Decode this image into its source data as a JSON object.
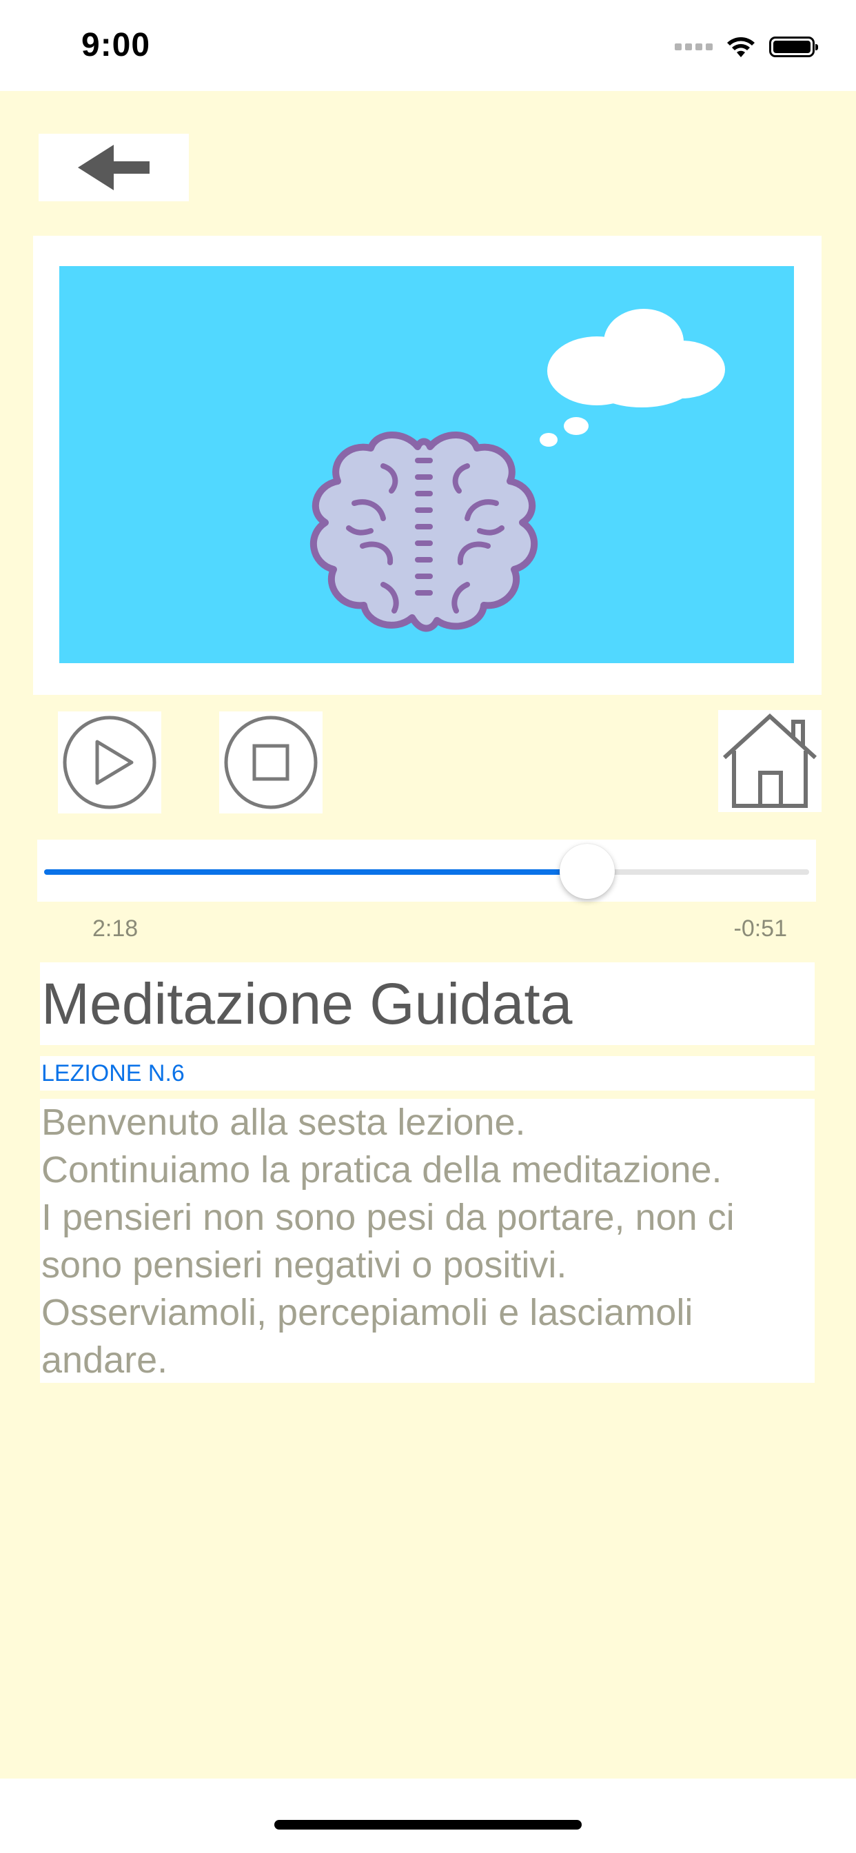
{
  "status_bar": {
    "time": "9:00"
  },
  "icons": {
    "back": "arrow-left-icon",
    "play": "play-circle-icon",
    "stop": "stop-circle-icon",
    "home": "house-icon",
    "illustration": "brain-thinking-illustration"
  },
  "player": {
    "progress": 0.71,
    "elapsed": "2:18",
    "remaining": "-0:51"
  },
  "lesson": {
    "title": "Meditazione Guidata",
    "number": "LEZIONE N.6",
    "description": "Benvenuto alla sesta lezione.\nContinuiamo la pratica della meditazione.\nI pensieri non sono pesi da portare, non ci sono pensieri negativi o positivi.\nOsserviamoli, percepiamoli e lasciamoli andare."
  },
  "colors": {
    "background": "#fffbd9",
    "accent": "#0a72e8",
    "illustration_sky": "#51d8ff",
    "brain_fill": "#c3cae6",
    "brain_stroke": "#8a66a8"
  }
}
